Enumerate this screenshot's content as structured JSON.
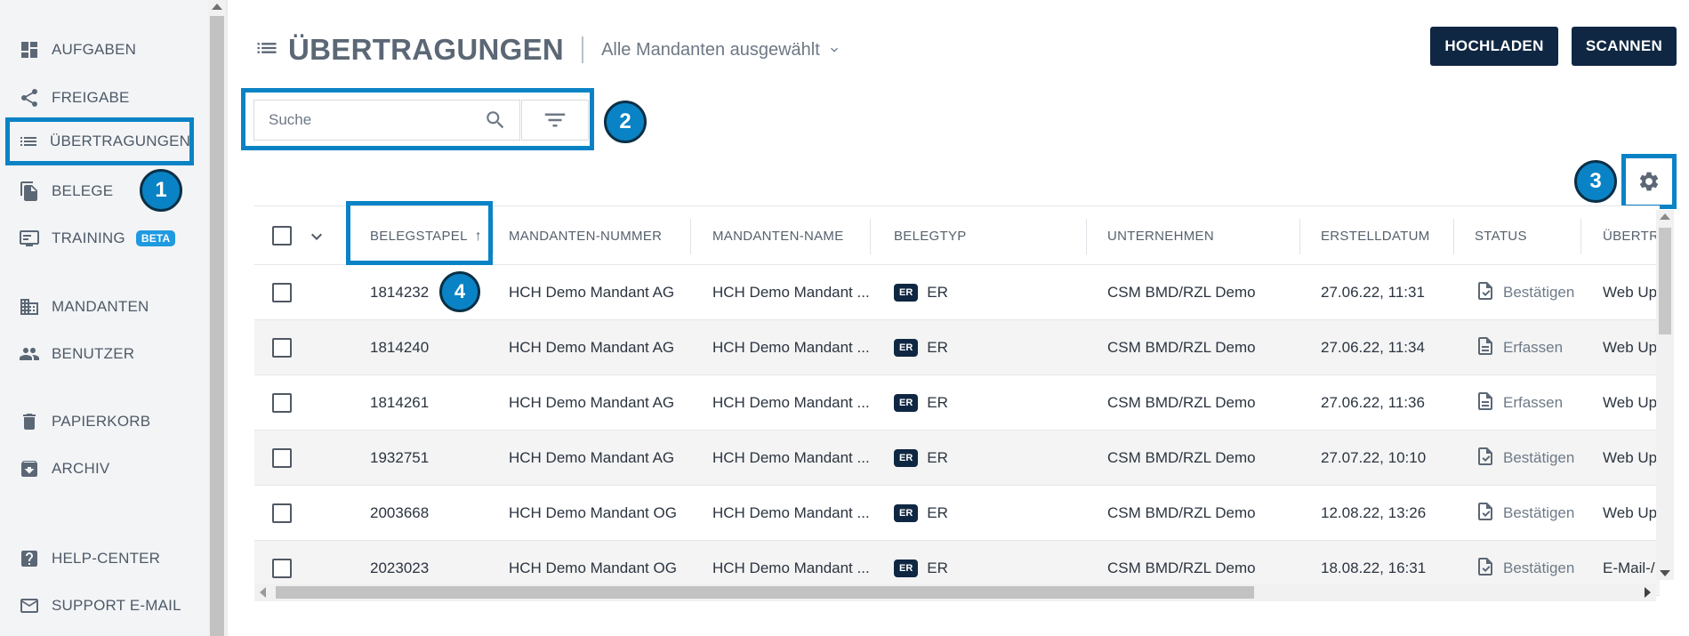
{
  "sidebar": {
    "items": [
      {
        "label": "AUFGABEN",
        "icon": "dashboard-icon"
      },
      {
        "label": "FREIGABE",
        "icon": "share-icon"
      },
      {
        "label": "ÜBERTRAGUNGEN",
        "icon": "list-icon",
        "selected": true
      },
      {
        "label": "BELEGE",
        "icon": "documents-icon"
      },
      {
        "label": "TRAINING",
        "icon": "training-icon",
        "badge": "BETA"
      },
      {
        "label": "MANDANTEN",
        "icon": "building-icon"
      },
      {
        "label": "BENUTZER",
        "icon": "users-icon"
      },
      {
        "label": "PAPIERKORB",
        "icon": "trash-icon"
      },
      {
        "label": "ARCHIV",
        "icon": "archive-icon"
      },
      {
        "label": "HELP-CENTER",
        "icon": "help-icon"
      },
      {
        "label": "SUPPORT E-MAIL",
        "icon": "mail-icon"
      }
    ]
  },
  "header": {
    "title": "ÜBERTRAGUNGEN",
    "mandant_select": "Alle Mandanten ausgewählt",
    "upload_label": "HOCHLADEN",
    "scan_label": "SCANNEN"
  },
  "search": {
    "placeholder": "Suche"
  },
  "callouts": [
    "1",
    "2",
    "3",
    "4"
  ],
  "table": {
    "columns": [
      "BELEGSTAPEL",
      "MANDANTEN-NUMMER",
      "MANDANTEN-NAME",
      "BELEGTYP",
      "UNTERNEHMEN",
      "ERSTELLDATUM",
      "STATUS",
      "ÜBERTR"
    ],
    "sort": {
      "column": "BELEGSTAPEL",
      "direction": "asc",
      "arrow": "↑"
    },
    "rows": [
      {
        "belegstapel": "1814232",
        "nummer": "HCH Demo Mandant AG",
        "name": "HCH Demo Mandant ...",
        "tag": "ER",
        "typ": "ER",
        "unternehmen": "CSM BMD/RZL Demo",
        "datum": "27.06.22, 11:31",
        "status": "Bestätigen",
        "status_icon": "doc-check-icon",
        "uebertr": "Web Up"
      },
      {
        "belegstapel": "1814240",
        "nummer": "HCH Demo Mandant AG",
        "name": "HCH Demo Mandant ...",
        "tag": "ER",
        "typ": "ER",
        "unternehmen": "CSM BMD/RZL Demo",
        "datum": "27.06.22, 11:34",
        "status": "Erfassen",
        "status_icon": "doc-lines-icon",
        "uebertr": "Web Up"
      },
      {
        "belegstapel": "1814261",
        "nummer": "HCH Demo Mandant AG",
        "name": "HCH Demo Mandant ...",
        "tag": "ER",
        "typ": "ER",
        "unternehmen": "CSM BMD/RZL Demo",
        "datum": "27.06.22, 11:36",
        "status": "Erfassen",
        "status_icon": "doc-lines-icon",
        "uebertr": "Web Up"
      },
      {
        "belegstapel": "1932751",
        "nummer": "HCH Demo Mandant AG",
        "name": "HCH Demo Mandant ...",
        "tag": "ER",
        "typ": "ER",
        "unternehmen": "CSM BMD/RZL Demo",
        "datum": "27.07.22, 10:10",
        "status": "Bestätigen",
        "status_icon": "doc-check-icon",
        "uebertr": "Web Up"
      },
      {
        "belegstapel": "2003668",
        "nummer": "HCH Demo Mandant OG",
        "name": "HCH Demo Mandant ...",
        "tag": "ER",
        "typ": "ER",
        "unternehmen": "CSM BMD/RZL Demo",
        "datum": "12.08.22, 13:26",
        "status": "Bestätigen",
        "status_icon": "doc-check-icon",
        "uebertr": "Web Up"
      },
      {
        "belegstapel": "2023023",
        "nummer": "HCH Demo Mandant OG",
        "name": "HCH Demo Mandant ...",
        "tag": "ER",
        "typ": "ER",
        "unternehmen": "CSM BMD/RZL Demo",
        "datum": "18.08.22, 16:31",
        "status": "Bestätigen",
        "status_icon": "doc-check-icon",
        "uebertr": "E-Mail-/"
      }
    ]
  },
  "colors": {
    "accent": "#0a83c6",
    "button": "#0f2742",
    "sidebar_bg": "#f3f4f6",
    "row_alt": "#f4f4f4"
  }
}
